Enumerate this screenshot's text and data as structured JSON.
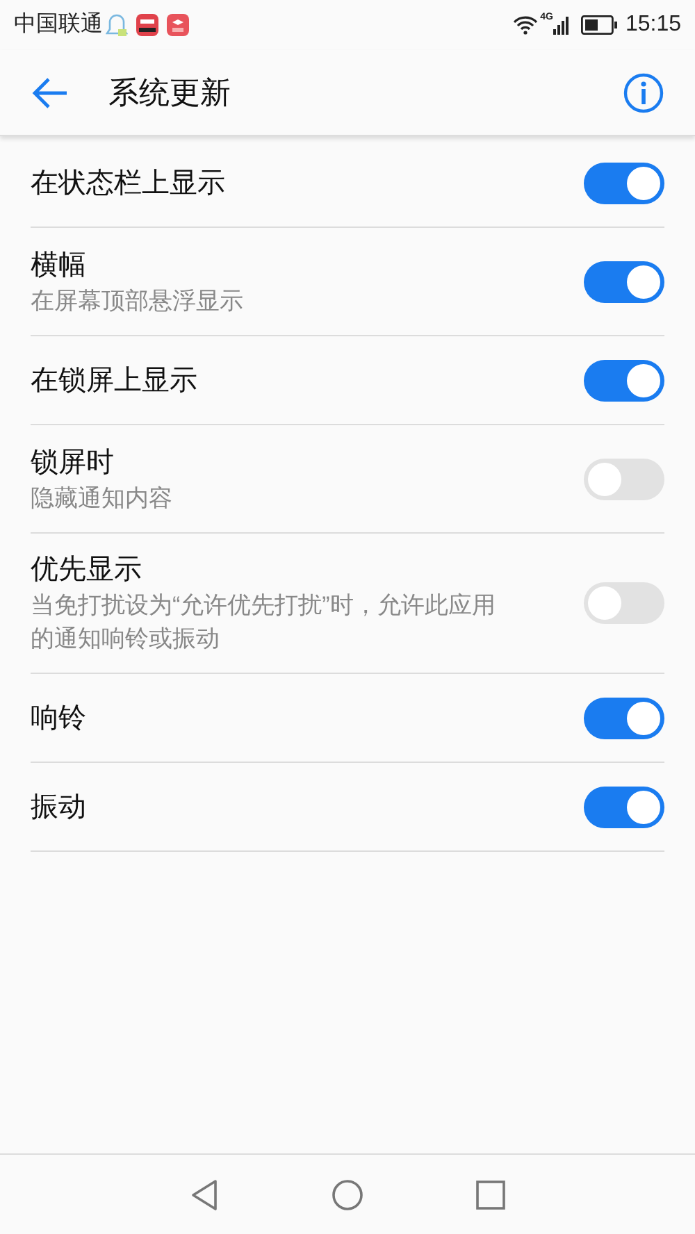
{
  "status_bar": {
    "carrier": "中国联通",
    "network": "4G",
    "time": "15:15"
  },
  "header": {
    "title": "系统更新"
  },
  "settings": [
    {
      "title": "在状态栏上显示",
      "on": true
    },
    {
      "title": "横幅",
      "subtitle": "在屏幕顶部悬浮显示",
      "on": true
    },
    {
      "title": "在锁屏上显示",
      "on": true
    },
    {
      "title": "锁屏时",
      "subtitle": "隐藏通知内容",
      "on": false
    },
    {
      "title": "优先显示",
      "subtitle": "当免打扰设为“允许优先打扰”时，允许此应用的通知响铃或振动",
      "on": false
    },
    {
      "title": "响铃",
      "on": true
    },
    {
      "title": "振动",
      "on": true
    }
  ]
}
